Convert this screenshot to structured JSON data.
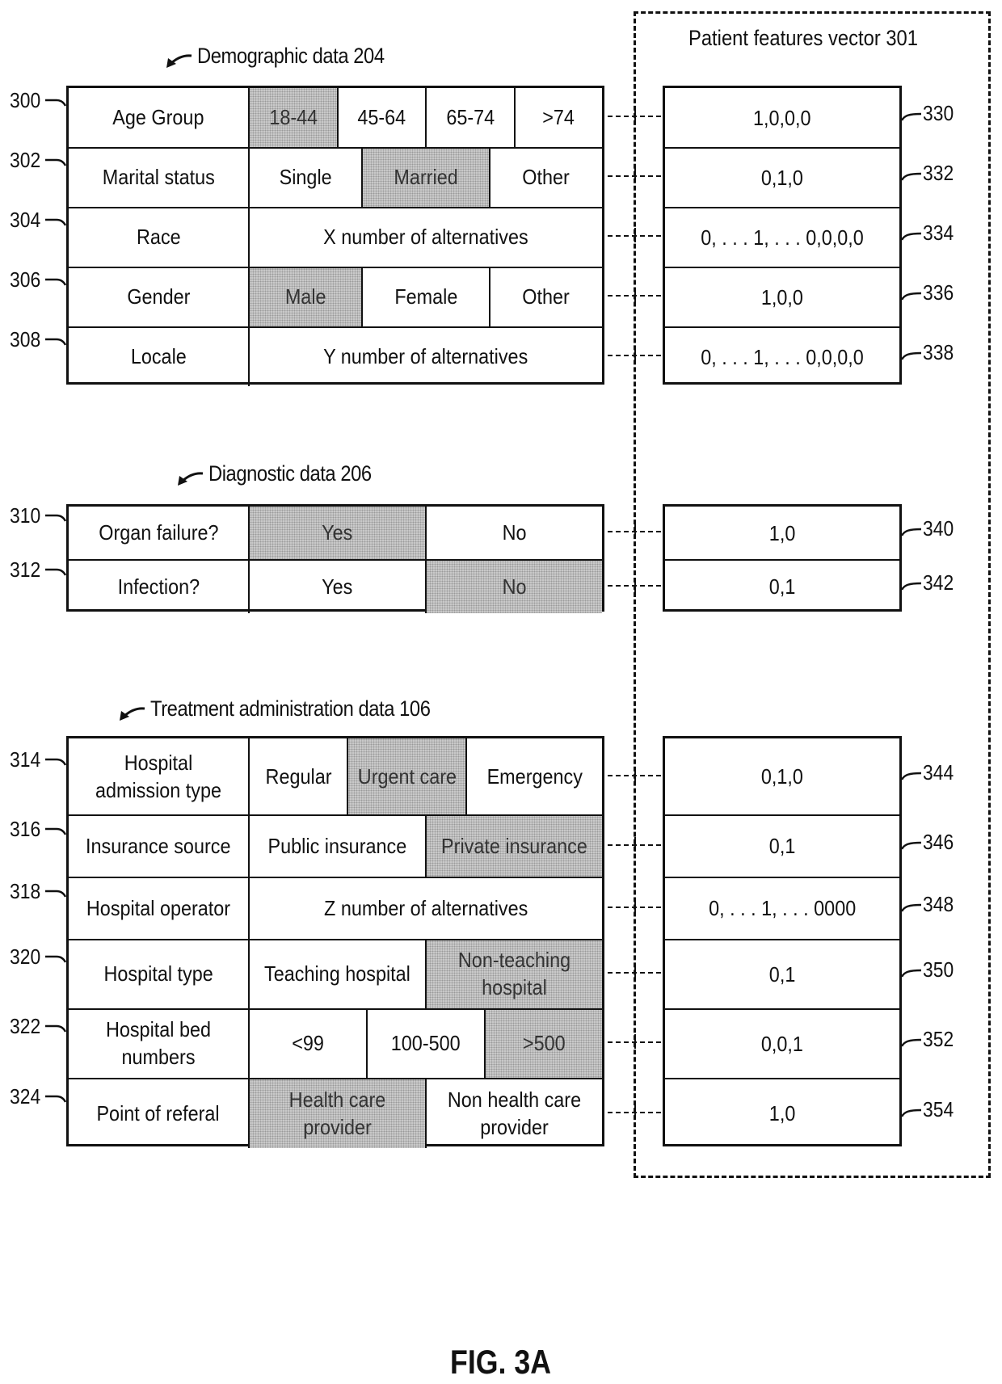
{
  "figure": {
    "caption": "FIG. 3A",
    "vector_title": "Patient features vector 301"
  },
  "sections": [
    {
      "title": "Demographic data 204",
      "rows": [
        {
          "ref": "300",
          "label": "Age Group",
          "options": [
            "18-44",
            "45-64",
            "65-74",
            ">74"
          ],
          "selected": [
            0
          ],
          "vector": "1,0,0,0",
          "vector_ref": "330"
        },
        {
          "ref": "302",
          "label": "Marital status",
          "options": [
            "Single",
            "Married",
            "Other"
          ],
          "selected": [
            1
          ],
          "vector": "0,1,0",
          "vector_ref": "332"
        },
        {
          "ref": "304",
          "label": "Race",
          "options": [
            "X number of alternatives"
          ],
          "selected": [],
          "vector": "0, . . . 1, . . . 0,0,0,0",
          "vector_ref": "334"
        },
        {
          "ref": "306",
          "label": "Gender",
          "options": [
            "Male",
            "Female",
            "Other"
          ],
          "selected": [
            0
          ],
          "vector": "1,0,0",
          "vector_ref": "336"
        },
        {
          "ref": "308",
          "label": "Locale",
          "options": [
            "Y number of alternatives"
          ],
          "selected": [],
          "vector": "0, . . . 1, . . . 0,0,0,0",
          "vector_ref": "338"
        }
      ]
    },
    {
      "title": "Diagnostic data 206",
      "rows": [
        {
          "ref": "310",
          "label": "Organ failure?",
          "options": [
            "Yes",
            "No"
          ],
          "selected": [
            0
          ],
          "vector": "1,0",
          "vector_ref": "340"
        },
        {
          "ref": "312",
          "label": "Infection?",
          "options": [
            "Yes",
            "No"
          ],
          "selected": [
            1
          ],
          "vector": "0,1",
          "vector_ref": "342"
        }
      ]
    },
    {
      "title": "Treatment administration data 106",
      "rows": [
        {
          "ref": "314",
          "label": "Hospital admission type",
          "options": [
            "Regular",
            "Urgent care",
            "Emergency"
          ],
          "selected": [
            1
          ],
          "vector": "0,1,0",
          "vector_ref": "344"
        },
        {
          "ref": "316",
          "label": "Insurance source",
          "options": [
            "Public insurance",
            "Private insurance"
          ],
          "selected": [
            1
          ],
          "vector": "0,1",
          "vector_ref": "346"
        },
        {
          "ref": "318",
          "label": "Hospital operator",
          "options": [
            "Z number of alternatives"
          ],
          "selected": [],
          "vector": "0, . . . 1, . . . 0000",
          "vector_ref": "348"
        },
        {
          "ref": "320",
          "label": "Hospital type",
          "options": [
            "Teaching hospital",
            "Non-teaching hospital"
          ],
          "selected": [
            1
          ],
          "vector": "0,1",
          "vector_ref": "350"
        },
        {
          "ref": "322",
          "label": "Hospital bed numbers",
          "options": [
            "<99",
            "100-500",
            ">500"
          ],
          "selected": [
            2
          ],
          "vector": "0,0,1",
          "vector_ref": "352"
        },
        {
          "ref": "324",
          "label": "Point of referal",
          "options": [
            "Health care provider",
            "Non health care provider"
          ],
          "selected": [
            0
          ],
          "vector": "1,0",
          "vector_ref": "354"
        }
      ]
    }
  ]
}
